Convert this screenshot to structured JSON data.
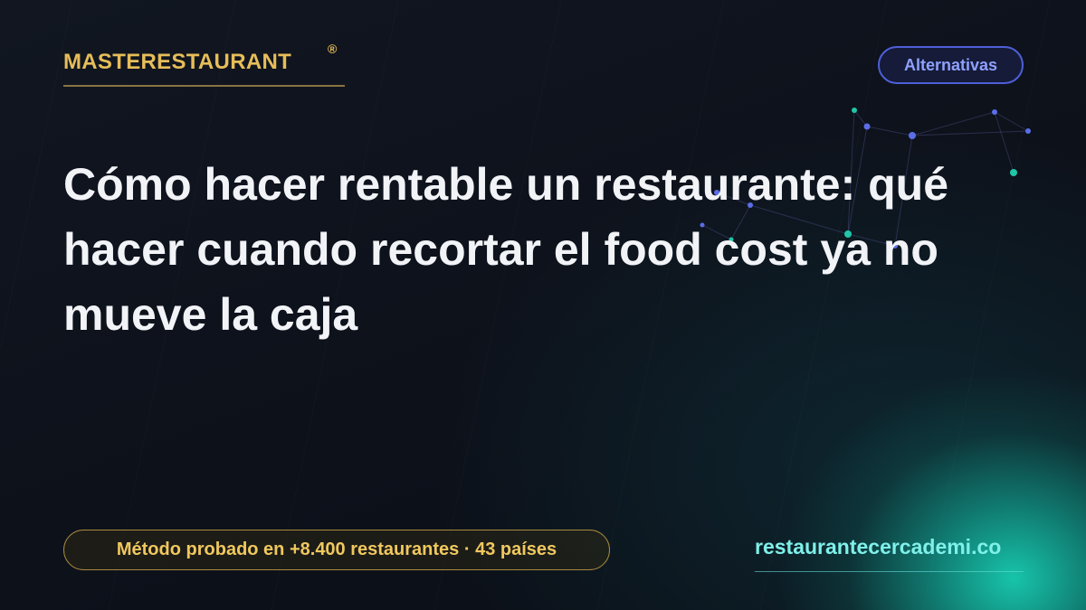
{
  "brand": {
    "name": "MASTERESTAURANT",
    "registered_mark": "®"
  },
  "category": {
    "label": "Alternativas"
  },
  "headline": "Cómo hacer rentable un restaurante: qué hacer cuando recortar el food cost ya no mueve la caja",
  "footer": {
    "badge_text": "Método probado en +8.400 restaurantes · 43 países",
    "site_url": "restaurantecercademi.co"
  },
  "colors": {
    "background": "#0c1018",
    "brand_gold": "#e6bd58",
    "pill_blue": "#8ea0ff",
    "headline_white": "#f1f3f7",
    "link_teal": "#7ff0ea",
    "glow_teal": "#18cdb2"
  }
}
